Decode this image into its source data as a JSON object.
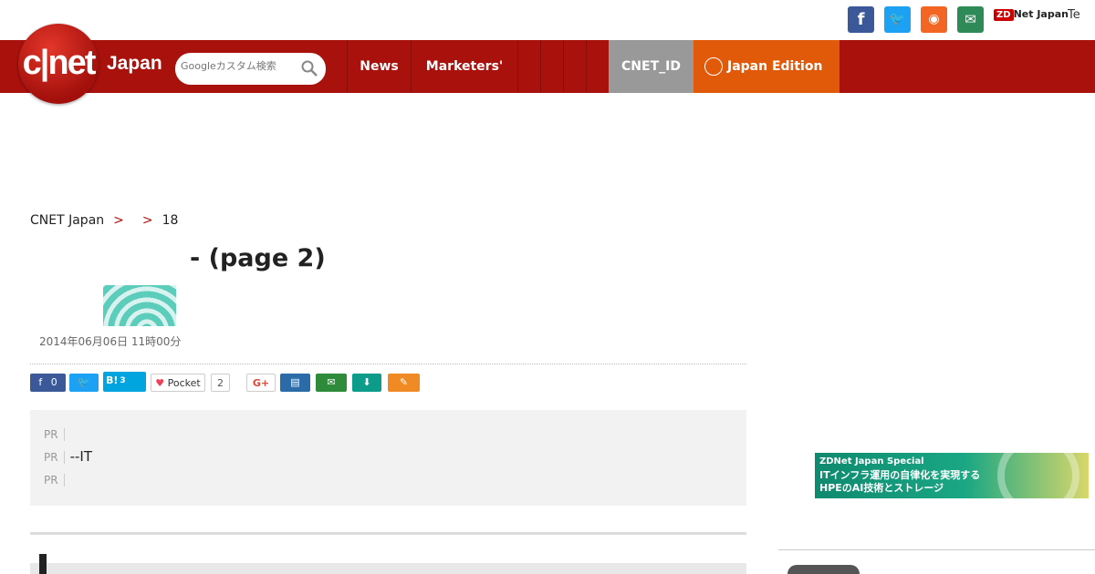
{
  "top": {
    "social": [
      "facebook-icon",
      "twitter-icon",
      "rss-icon",
      "mail-icon"
    ],
    "zdnet": "ZDNet Japan",
    "zd": "ZD",
    "zdnet_rest": "Net Japan",
    "tc": "Te"
  },
  "nav": {
    "logo": "c|net",
    "edition": "Japan",
    "search_placeholder": "Googleカスタム検索",
    "items": [
      "News",
      "Marketers'"
    ],
    "cnet_id": "CNET_ID",
    "japan_edition": "Japan Edition"
  },
  "breadcrumb": [
    "CNET Japan",
    "",
    "18"
  ],
  "article": {
    "title": " - (page 2)",
    "byline": "",
    "date": "2014年06月06日 11時00分"
  },
  "share": {
    "hatena_label": "B!",
    "hatena_count": "3",
    "pocket": "Pocket",
    "pocket_count": "2",
    "fb_count": "0",
    "gplus": "G+"
  },
  "pr": {
    "tag": "PR",
    "items": [
      "",
      "--IT",
      ""
    ]
  },
  "banner": {
    "title": "ZDNet Japan Special",
    "line1": "ITインフラ運用の自律化を実現する",
    "line2": "HPEのAI技術とストレージ"
  },
  "sidebar": {
    "heading": ""
  },
  "colors": {
    "brand": "#a9110d",
    "accent": "#e05a0a",
    "facebook": "#3b5998",
    "twitter": "#1da1f2",
    "rss": "#f26522",
    "mail": "#2e8b57"
  }
}
